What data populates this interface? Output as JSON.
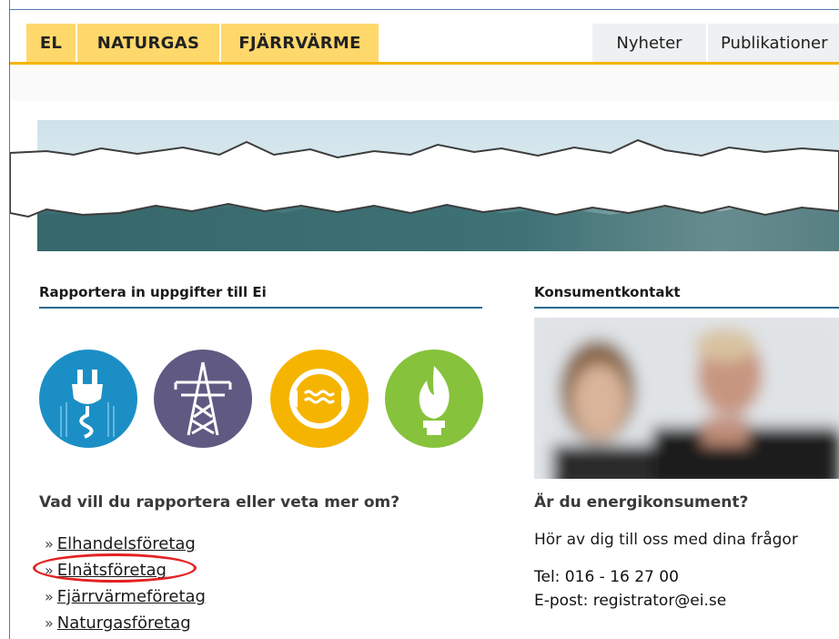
{
  "nav": {
    "tabs": [
      {
        "label": "EL"
      },
      {
        "label": "NATURGAS"
      },
      {
        "label": "FJÄRRVÄRME"
      }
    ],
    "utility": [
      {
        "label": "Nyheter"
      },
      {
        "label": "Publikationer"
      }
    ]
  },
  "report": {
    "title": "Rapportera in uppgifter till Ei",
    "icons": [
      {
        "name": "plug-icon",
        "color": "#1b8fc5"
      },
      {
        "name": "power-tower-icon",
        "color": "#605a83"
      },
      {
        "name": "district-heating-icon",
        "color": "#f5b400"
      },
      {
        "name": "gas-flame-icon",
        "color": "#86c23b"
      }
    ],
    "question": "Vad vill du rapportera eller veta mer om?",
    "links": [
      {
        "label": "Elhandelsföretag"
      },
      {
        "label": "Elnätsföretag",
        "highlighted": true
      },
      {
        "label": "Fjärrvärmeföretag"
      },
      {
        "label": "Naturgasföretag"
      }
    ]
  },
  "consumer": {
    "title": "Konsumentkontakt",
    "question": "Är du energikonsument?",
    "text": "Hör av dig till oss med dina frågor",
    "tel_label": "Tel: 016 - 16 27 00",
    "email_prefix": "E-post: ",
    "email": "registrator@ei.se"
  },
  "colors": {
    "tab_yellow": "#ffd86b",
    "accent_line": "#f5b400",
    "section_rule": "#2b6a8c",
    "highlight": "#e32122"
  },
  "raquo": "»"
}
